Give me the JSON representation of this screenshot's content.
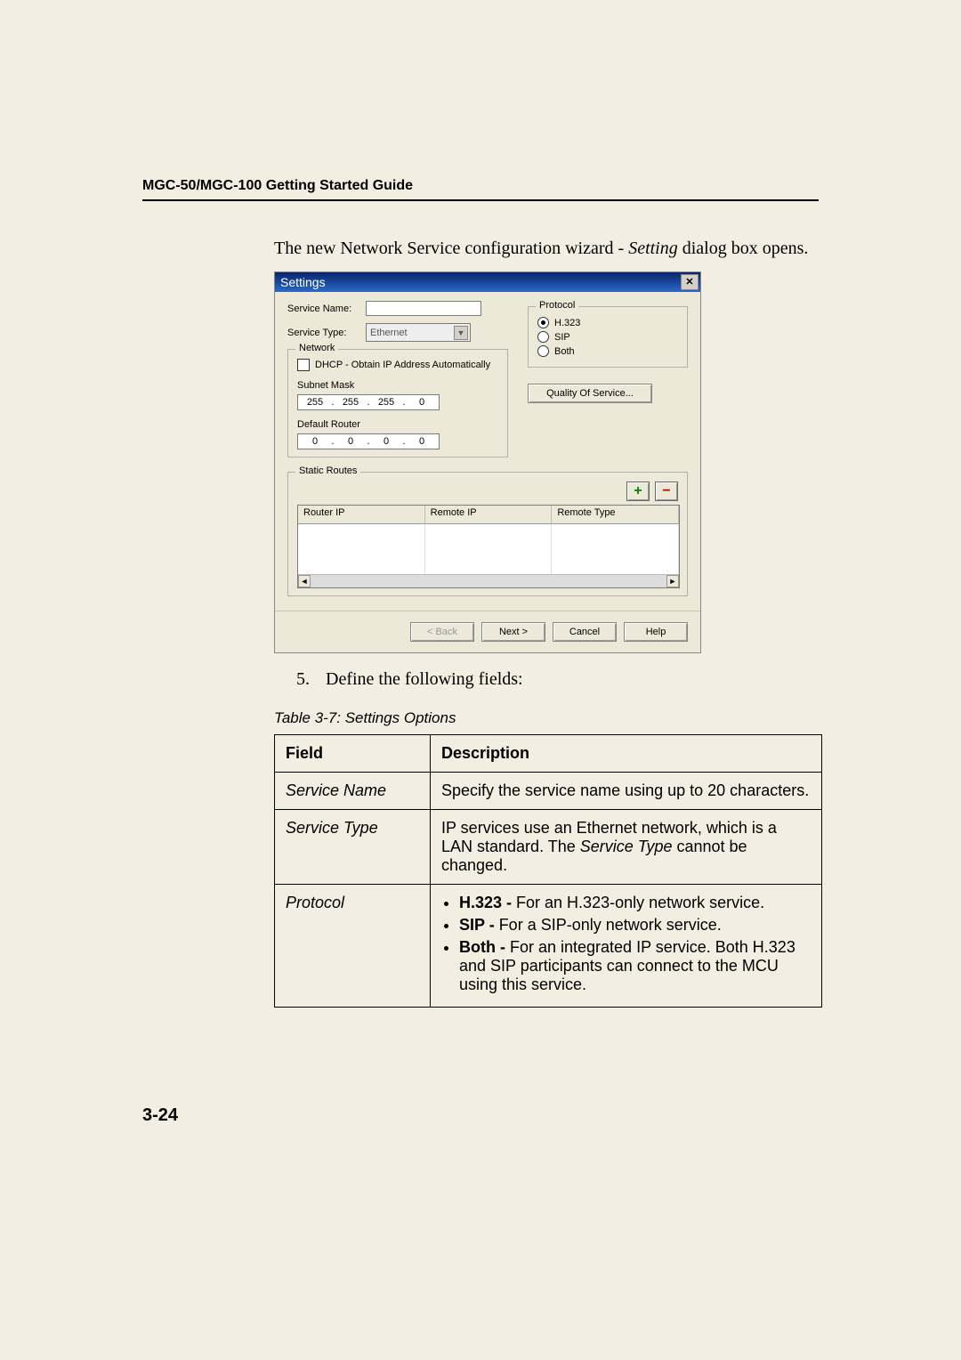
{
  "header": {
    "running_head": "MGC-50/MGC-100 Getting Started Guide"
  },
  "intro": {
    "pre": "The new Network Service configuration wizard - ",
    "italic": "Setting",
    "post": " dialog box opens."
  },
  "dialog": {
    "title": "Settings",
    "service_name_label": "Service Name:",
    "service_name_value": "",
    "service_type_label": "Service Type:",
    "service_type_value": "Ethernet",
    "network_legend": "Network",
    "dhcp_label": "DHCP - Obtain IP Address Automatically",
    "subnet_label": "Subnet Mask",
    "subnet_octets": [
      "255",
      "255",
      "255",
      "0"
    ],
    "default_router_label": "Default Router",
    "router_octets": [
      "0",
      "0",
      "0",
      "0"
    ],
    "protocol_legend": "Protocol",
    "protocol_options": {
      "h323": "H.323",
      "sip": "SIP",
      "both": "Both"
    },
    "protocol_selected": "h323",
    "qos_button": "Quality Of Service...",
    "static_legend": "Static Routes",
    "routes_headers": {
      "router_ip": "Router IP",
      "remote_ip": "Remote IP",
      "remote_type": "Remote Type"
    },
    "wizard": {
      "back": "< Back",
      "next": "Next >",
      "cancel": "Cancel",
      "help": "Help"
    }
  },
  "step": {
    "number": "5.",
    "text": "Define the following fields:"
  },
  "table": {
    "caption": "Table 3-7: Settings Options",
    "header_field": "Field",
    "header_desc": "Description",
    "rows": {
      "service_name": {
        "field": "Service Name",
        "desc": "Specify the service name using up to 20 characters."
      },
      "service_type": {
        "field": "Service Type",
        "desc_pre": "IP services use an Ethernet network, which is a LAN standard. The ",
        "desc_italic": "Service Type",
        "desc_post": " cannot be changed."
      },
      "protocol": {
        "field": "Protocol",
        "h323_bold": "H.323 - ",
        "h323_rest": "For an H.323-only network service.",
        "sip_bold": "SIP - ",
        "sip_rest": "For a SIP-only network service.",
        "both_bold": "Both - ",
        "both_rest": "For an integrated IP service. Both H.323 and SIP participants can connect to the MCU using this service."
      }
    }
  },
  "page_number": "3-24"
}
